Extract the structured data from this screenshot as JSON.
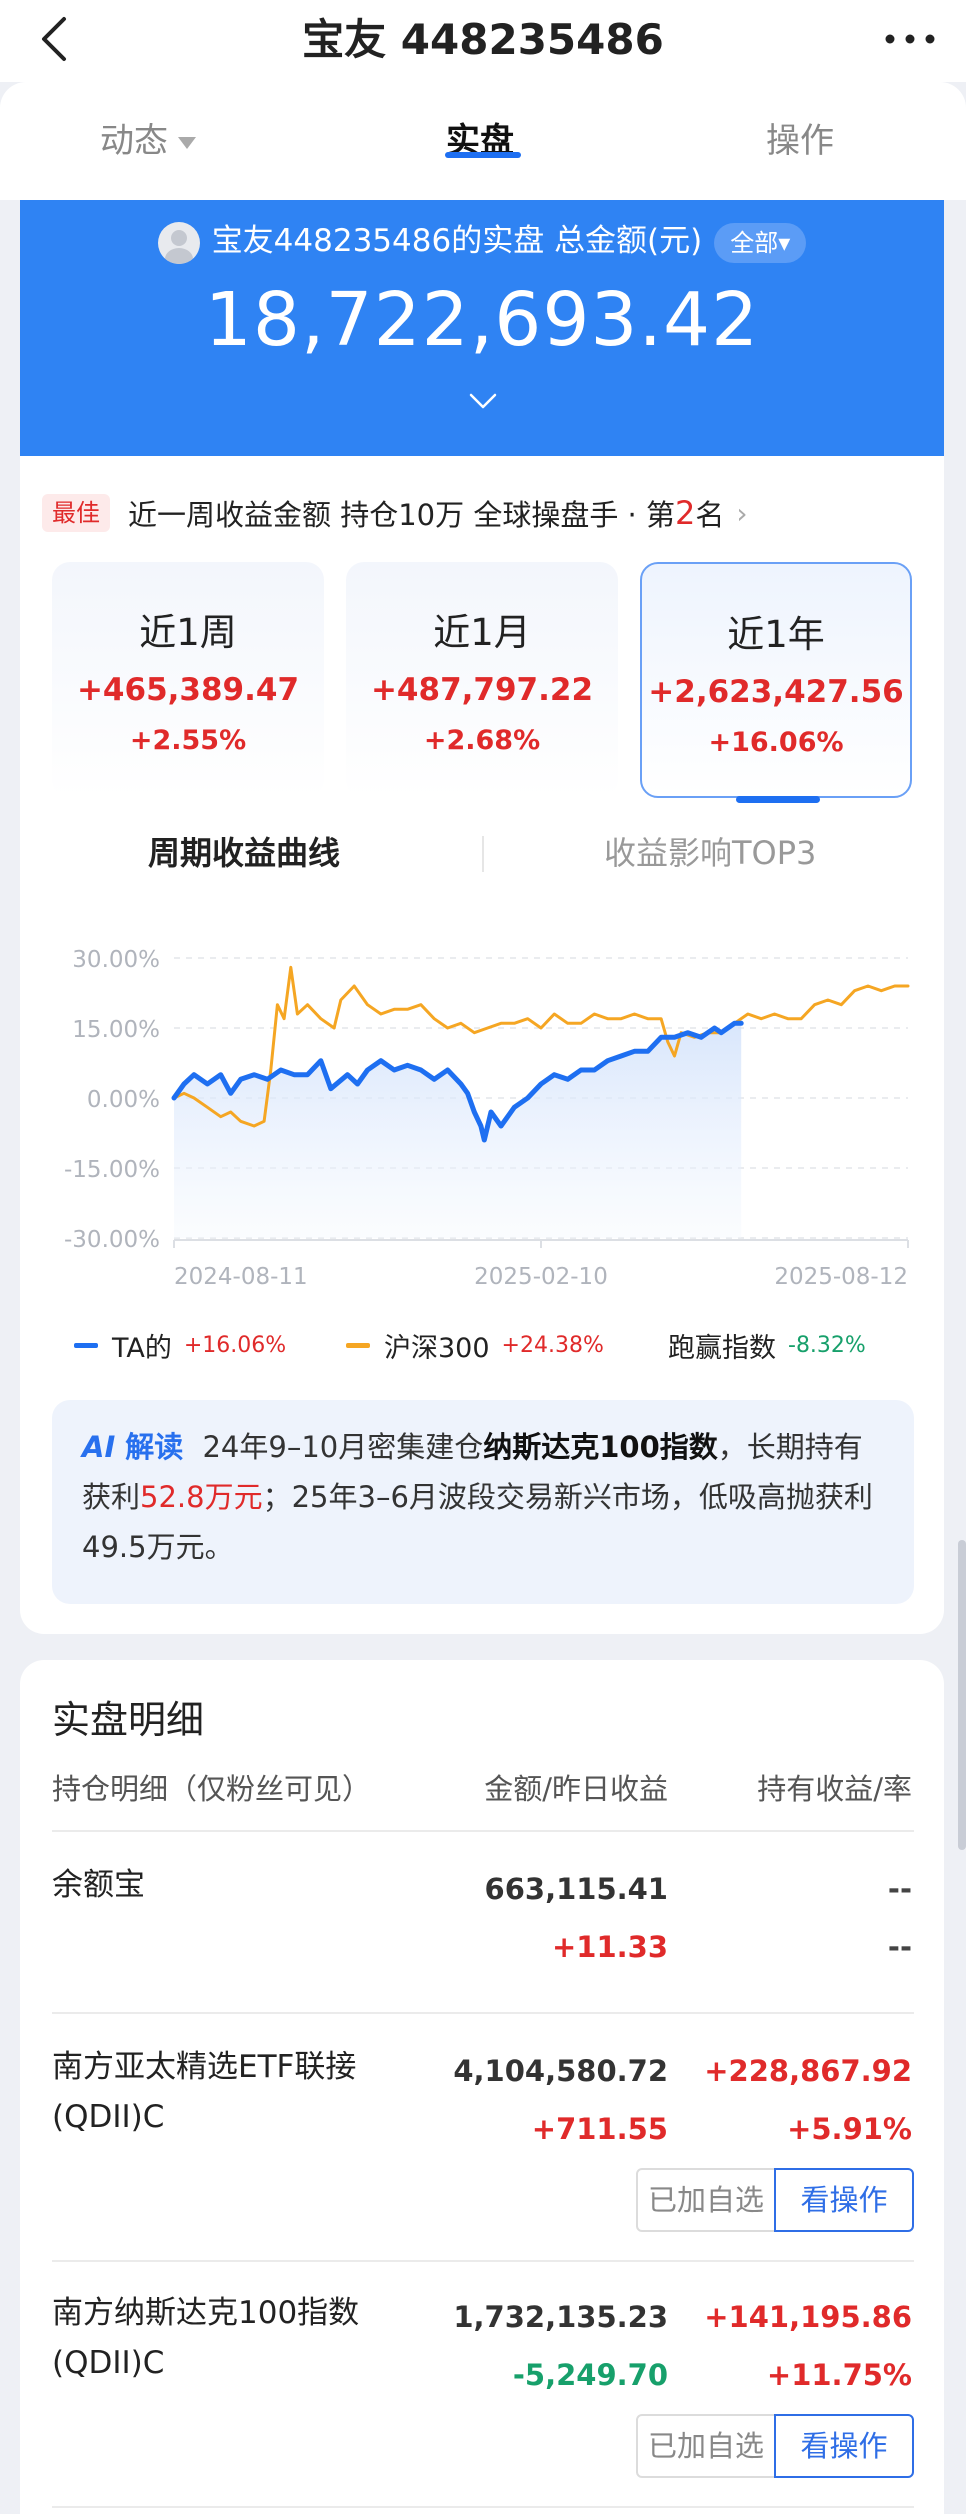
{
  "nav": {
    "title": "宝友 448235486",
    "back_icon": "chevron-left-icon",
    "more_icon": "more-dots-icon"
  },
  "tabs": [
    {
      "label": "动态"
    },
    {
      "label": "实盘"
    },
    {
      "label": "操作"
    }
  ],
  "active_tab": "实盘",
  "summary": {
    "owner_label": "宝友448235486的实盘",
    "total_label": "总金额(元)",
    "filter_label": "全部",
    "total_value": "18,722,693.42"
  },
  "ranking": {
    "tag": "最佳",
    "text_before": "近一周收益金额 持仓10万 全球操盘手 · 第",
    "rank": "2",
    "text_after": "名"
  },
  "periods": [
    {
      "label": "近1周",
      "amount": "+465,389.47",
      "percent": "+2.55%"
    },
    {
      "label": "近1月",
      "amount": "+487,797.22",
      "percent": "+2.68%"
    },
    {
      "label": "近1年",
      "amount": "+2,623,427.56",
      "percent": "+16.06%"
    }
  ],
  "selected_period": "近1年",
  "subtabs": {
    "curve": "周期收益曲线",
    "top3": "收益影响TOP3"
  },
  "chart_data": {
    "type": "line",
    "title": "",
    "ylim": [
      -30,
      30
    ],
    "yticks": [
      "30.00%",
      "15.00%",
      "0.00%",
      "-15.00%",
      "-30.00%"
    ],
    "yvalues": [
      30,
      15,
      0,
      -15,
      -30
    ],
    "xticks": [
      "2024-08-11",
      "2025-02-10",
      "2025-08-12"
    ],
    "grid": true,
    "series": [
      {
        "name": "TA的",
        "color": "#1e6ff1",
        "points": [
          [
            0,
            0
          ],
          [
            3,
            3
          ],
          [
            6,
            5
          ],
          [
            10,
            3
          ],
          [
            14,
            5
          ],
          [
            17,
            1
          ],
          [
            20,
            4
          ],
          [
            24,
            5
          ],
          [
            28,
            4
          ],
          [
            32,
            6
          ],
          [
            36,
            5
          ],
          [
            40,
            5
          ],
          [
            44,
            8
          ],
          [
            47,
            2
          ],
          [
            52,
            5
          ],
          [
            55,
            3
          ],
          [
            58,
            6
          ],
          [
            62,
            8
          ],
          [
            66,
            6
          ],
          [
            70,
            7
          ],
          [
            74,
            6
          ],
          [
            78,
            4
          ],
          [
            82,
            6
          ],
          [
            86,
            3
          ],
          [
            88,
            1
          ],
          [
            90,
            -3
          ],
          [
            92,
            -6
          ],
          [
            93,
            -9
          ],
          [
            95,
            -3
          ],
          [
            98,
            -6
          ],
          [
            102,
            -2
          ],
          [
            106,
            0
          ],
          [
            110,
            3
          ],
          [
            114,
            5
          ],
          [
            118,
            4
          ],
          [
            122,
            6
          ],
          [
            126,
            6
          ],
          [
            130,
            8
          ],
          [
            134,
            9
          ],
          [
            138,
            10
          ],
          [
            142,
            10
          ],
          [
            146,
            13
          ],
          [
            150,
            13
          ],
          [
            154,
            14
          ],
          [
            158,
            13
          ],
          [
            162,
            15
          ],
          [
            164,
            14
          ],
          [
            168,
            16
          ],
          [
            170,
            16
          ]
        ]
      },
      {
        "name": "沪深300",
        "color": "#f5a623",
        "points": [
          [
            0,
            0
          ],
          [
            3,
            1
          ],
          [
            6,
            0
          ],
          [
            10,
            -2
          ],
          [
            14,
            -4
          ],
          [
            17,
            -3
          ],
          [
            20,
            -5
          ],
          [
            24,
            -6
          ],
          [
            27,
            -5
          ],
          [
            29,
            6
          ],
          [
            31,
            20
          ],
          [
            33,
            17
          ],
          [
            35,
            28
          ],
          [
            37,
            18
          ],
          [
            40,
            20
          ],
          [
            44,
            17
          ],
          [
            48,
            15
          ],
          [
            50,
            21
          ],
          [
            54,
            24
          ],
          [
            58,
            20
          ],
          [
            62,
            18
          ],
          [
            66,
            19
          ],
          [
            70,
            19
          ],
          [
            74,
            20
          ],
          [
            78,
            17
          ],
          [
            82,
            15
          ],
          [
            86,
            16
          ],
          [
            90,
            14
          ],
          [
            94,
            15
          ],
          [
            98,
            16
          ],
          [
            102,
            16
          ],
          [
            106,
            17
          ],
          [
            110,
            15
          ],
          [
            114,
            18
          ],
          [
            118,
            16
          ],
          [
            122,
            16
          ],
          [
            126,
            18
          ],
          [
            130,
            17
          ],
          [
            134,
            17
          ],
          [
            138,
            18
          ],
          [
            142,
            17
          ],
          [
            146,
            17
          ],
          [
            148,
            12
          ],
          [
            150,
            9
          ],
          [
            152,
            14
          ],
          [
            156,
            13
          ],
          [
            160,
            14
          ],
          [
            164,
            14
          ],
          [
            168,
            16
          ],
          [
            172,
            18
          ],
          [
            176,
            17
          ],
          [
            180,
            18
          ],
          [
            184,
            17
          ],
          [
            188,
            17
          ],
          [
            192,
            20
          ],
          [
            196,
            21
          ],
          [
            200,
            20
          ],
          [
            204,
            23
          ],
          [
            208,
            24
          ],
          [
            212,
            23
          ],
          [
            216,
            24
          ],
          [
            220,
            24
          ]
        ]
      }
    ]
  },
  "legend": [
    {
      "name": "TA的",
      "value": "+16.06%"
    },
    {
      "name": "沪深300",
      "value": "+24.38%"
    },
    {
      "name": "跑赢指数",
      "value": "-8.32%"
    }
  ],
  "ai": {
    "label": "解读",
    "p1": "24年9–10月密集建仓",
    "bold": "纳斯达克100指数",
    "p2": "，长期持有获利",
    "highlight": "52.8万元",
    "p3": "；25年3–6月波段交易新兴市场，低吸高抛获利49.5万元。"
  },
  "detail": {
    "title": "实盘明细",
    "headers": [
      "持仓明细（仅粉丝可见）",
      "金额/昨日收益",
      "持有收益/率"
    ],
    "added_label": "已加自选",
    "view_label": "看操作",
    "rows": [
      {
        "name": "余额宝",
        "amount": "663,115.41",
        "yesterday": "+11.33",
        "hold": "--",
        "rate": "--"
      },
      {
        "name": "南方亚太精选ETF联接(QDII)C",
        "amount": "4,104,580.72",
        "yesterday": "+711.55",
        "hold": "+228,867.92",
        "rate": "+5.91%"
      },
      {
        "name": "南方纳斯达克100指数(QDII)C",
        "amount": "1,732,135.23",
        "yesterday": "-5,249.70",
        "hold": "+141,195.86",
        "rate": "+11.75%"
      }
    ]
  }
}
